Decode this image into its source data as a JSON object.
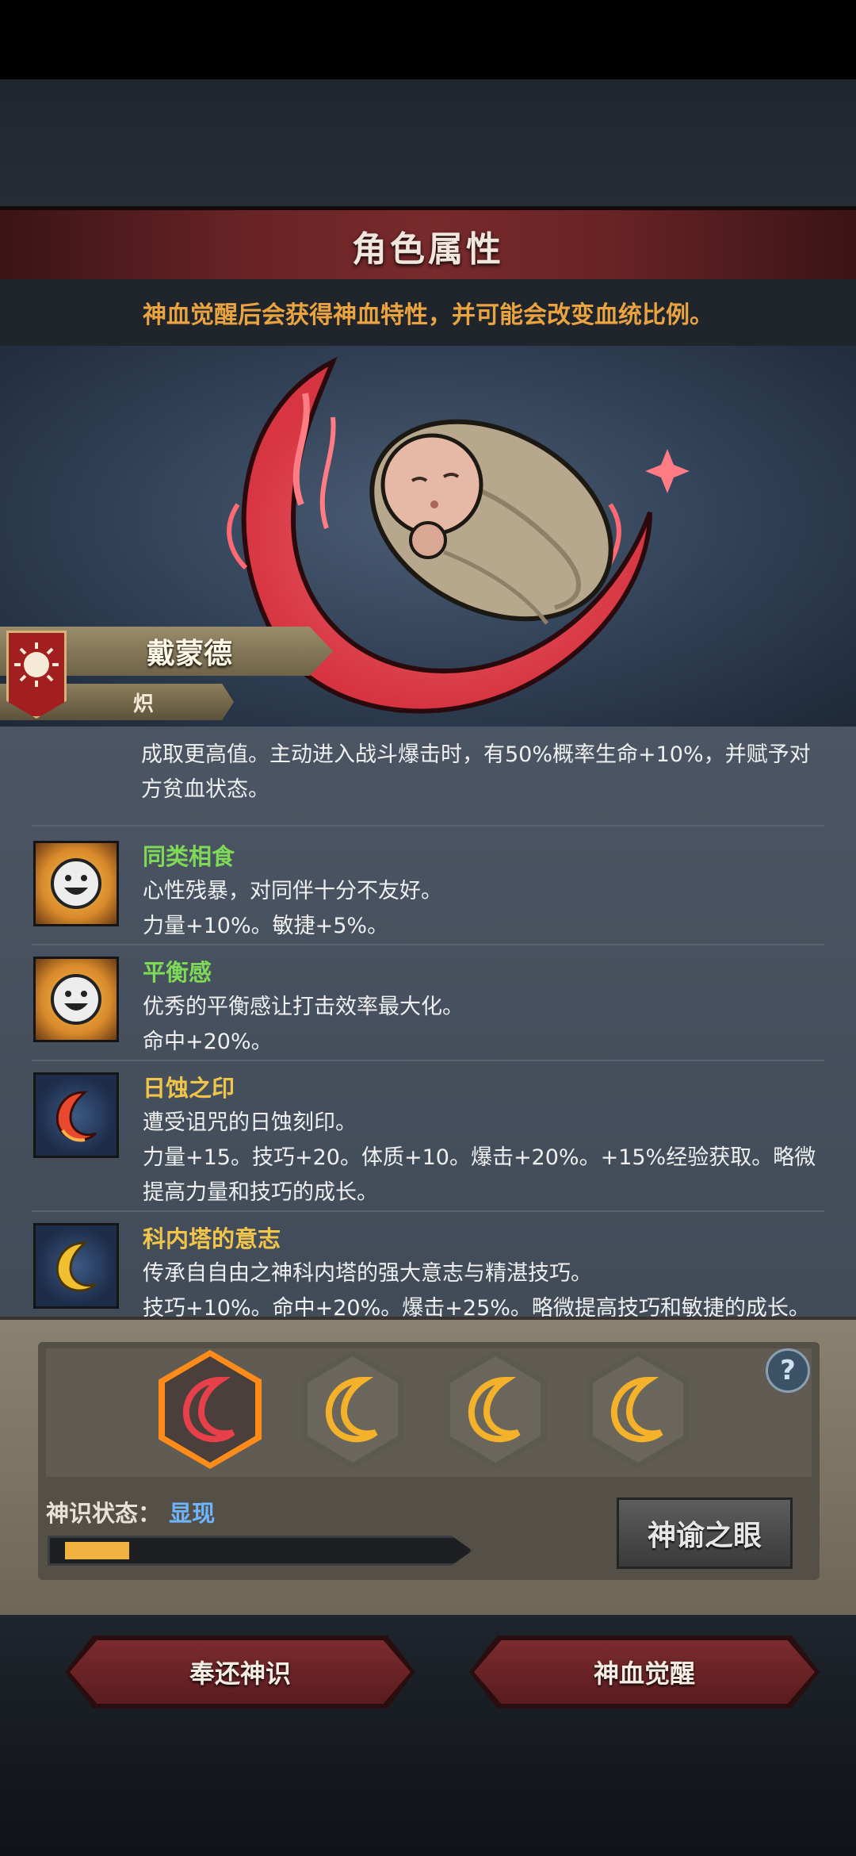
{
  "header": {
    "title": "角色属性",
    "hint": "神血觉醒后会获得神血特性，并可能会改变血统比例。"
  },
  "character": {
    "name": "戴蒙德",
    "title": "炽"
  },
  "traits": {
    "partial_text_1": "成取更高值。主动进入战斗爆击时，有50%概率生命+10%，并赋予对",
    "partial_text_2": "方贫血状态。",
    "items": [
      {
        "name": "同类相食",
        "desc": "心性残暴，对同伴十分不友好。",
        "effect": "力量+10%。敏捷+5%。",
        "name_color": "#7ed957"
      },
      {
        "name": "平衡感",
        "desc": "优秀的平衡感让打击效率最大化。",
        "effect": "命中+20%。",
        "name_color": "#7ed957"
      },
      {
        "name": "日蚀之印",
        "desc": "遭受诅咒的日蚀刻印。",
        "effect": "力量+15。技巧+20。体质+10。爆击+20%。+15%经验获取。略微",
        "effect2": "提高力量和技巧的成长。",
        "name_color": "#f0c54a"
      },
      {
        "name": "科内塔的意志",
        "desc": "传承自自由之神科内塔的强大意志与精湛技巧。",
        "effect": "技巧+10%。命中+20%。爆击+25%。略微提高技巧和敏捷的成长。",
        "name_color": "#f0c54a"
      }
    ]
  },
  "awakening": {
    "help": "?",
    "status_label": "神识状态：",
    "status_value": "显现",
    "progress": 0.17,
    "oracle_button": "神谕之眼"
  },
  "buttons": {
    "return": "奉还神识",
    "awaken": "神血觉醒"
  },
  "colors": {
    "accent_red": "#7b2b2e",
    "hint_orange": "#e9a340",
    "status_blue": "#6fb4ff",
    "progress_fill": "#f2b23f"
  }
}
